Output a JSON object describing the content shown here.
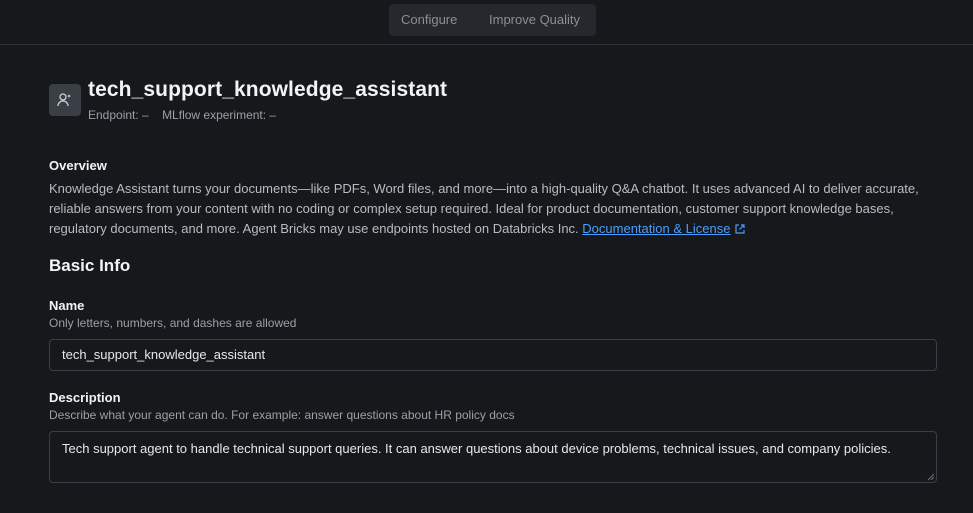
{
  "tabs": [
    {
      "label": "Configure"
    },
    {
      "label": "Improve Quality"
    }
  ],
  "header": {
    "title": "tech_support_knowledge_assistant",
    "endpoint": "Endpoint: –",
    "mlflow": "MLflow experiment: –",
    "icon": "agent-icon"
  },
  "overview": {
    "label": "Overview",
    "text": "Knowledge Assistant turns your documents—like PDFs, Word files, and more—into a high-quality Q&A chatbot. It uses advanced AI to deliver accurate, reliable answers from your content with no coding or complex setup required. Ideal for product documentation, customer support knowledge bases, regulatory documents, and more. Agent Bricks may use endpoints hosted on Databricks Inc.",
    "link_label": "Documentation & License"
  },
  "basic_info": {
    "heading": "Basic Info",
    "name": {
      "label": "Name",
      "hint": "Only letters, numbers, and dashes are allowed",
      "value": "tech_support_knowledge_assistant"
    },
    "description": {
      "label": "Description",
      "hint": "Describe what your agent can do. For example: answer questions about HR policy docs",
      "value": "Tech support agent to handle technical support queries. It can answer questions about device problems, technical issues, and company policies."
    }
  },
  "colors": {
    "background": "#16181b",
    "link": "#4a9eff",
    "muted": "#9aa0a6"
  }
}
